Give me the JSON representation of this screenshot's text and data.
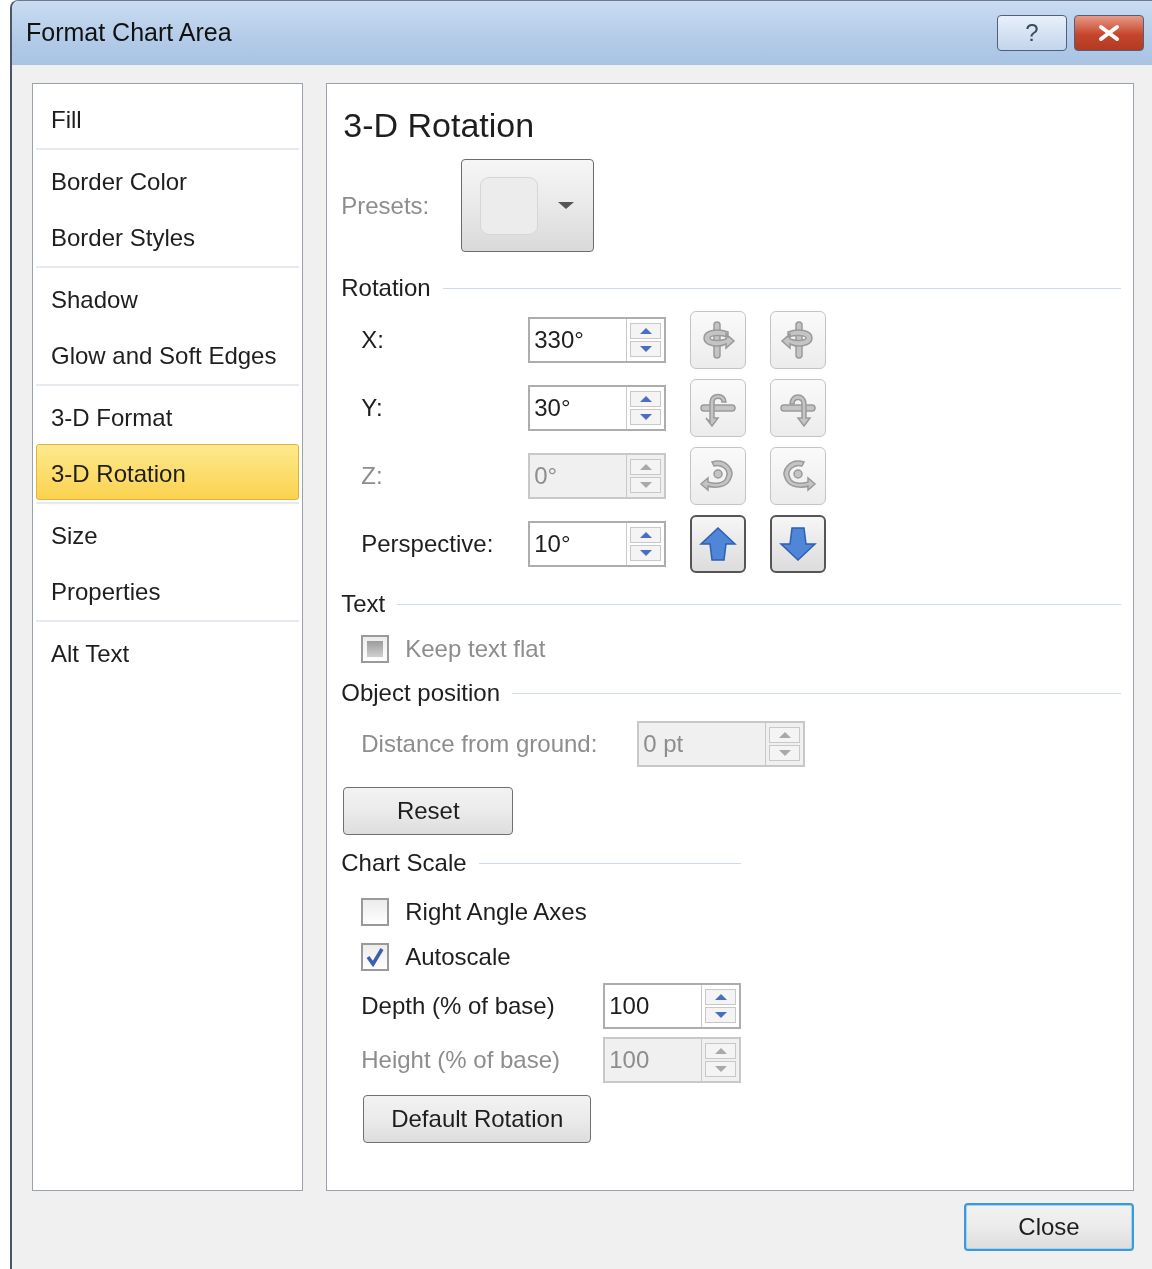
{
  "window": {
    "title": "Format Chart Area",
    "buttons": [
      {
        "kind": "help",
        "label": "?"
      },
      {
        "kind": "close"
      }
    ]
  },
  "sidebar": {
    "groups": [
      {
        "items": [
          {
            "label": "Fill",
            "selected": false
          }
        ]
      },
      {
        "items": [
          {
            "label": "Border Color",
            "selected": false
          },
          {
            "label": "Border Styles",
            "selected": false
          }
        ]
      },
      {
        "items": [
          {
            "label": "Shadow",
            "selected": false
          },
          {
            "label": "Glow and Soft Edges",
            "selected": false
          }
        ]
      },
      {
        "items": [
          {
            "label": "3-D Format",
            "selected": false
          },
          {
            "label": "3-D Rotation",
            "selected": true
          }
        ]
      },
      {
        "items": [
          {
            "label": "Size",
            "selected": false
          },
          {
            "label": "Properties",
            "selected": false
          }
        ]
      },
      {
        "items": [
          {
            "label": "Alt Text",
            "selected": false
          }
        ]
      }
    ]
  },
  "panel": {
    "heading": "3-D Rotation",
    "presets": {
      "label": "Presets:",
      "disabled": true
    },
    "rotation": {
      "title": "Rotation",
      "rows": [
        {
          "label": "X:",
          "value": "330°",
          "disabled": false,
          "buttons": [
            {
              "kind": "x-left"
            },
            {
              "kind": "x-right"
            }
          ]
        },
        {
          "label": "Y:",
          "value": "30°",
          "disabled": false,
          "buttons": [
            {
              "kind": "y-up"
            },
            {
              "kind": "y-down"
            }
          ]
        },
        {
          "label": "Z:",
          "value": "0°",
          "disabled": true,
          "buttons": [
            {
              "kind": "z-cw"
            },
            {
              "kind": "z-ccw"
            }
          ]
        },
        {
          "label": "Perspective:",
          "value": "10°",
          "disabled": false,
          "buttons": [
            {
              "kind": "narrow"
            },
            {
              "kind": "widen"
            }
          ]
        }
      ]
    },
    "text": {
      "title": "Text",
      "checkbox": {
        "label": "Keep text flat",
        "checked": false,
        "indeterminate": true,
        "disabled": true
      }
    },
    "object_position": {
      "title": "Object position",
      "field": {
        "label": "Distance from ground:",
        "value": "0 pt",
        "disabled": true
      }
    },
    "reset_button": {
      "label": "Reset"
    },
    "chart_scale": {
      "title": "Chart Scale",
      "checkboxes": [
        {
          "label": "Right Angle Axes",
          "checked": false,
          "disabled": false
        },
        {
          "label": "Autoscale",
          "checked": true,
          "disabled": false
        }
      ],
      "fields": [
        {
          "label": "Depth (% of base)",
          "value": "100",
          "disabled": false
        },
        {
          "label": "Height (% of base)",
          "value": "100",
          "disabled": true
        }
      ],
      "default_button": {
        "label": "Default Rotation"
      }
    }
  },
  "footer": {
    "close_button": {
      "label": "Close",
      "focused": true
    }
  }
}
